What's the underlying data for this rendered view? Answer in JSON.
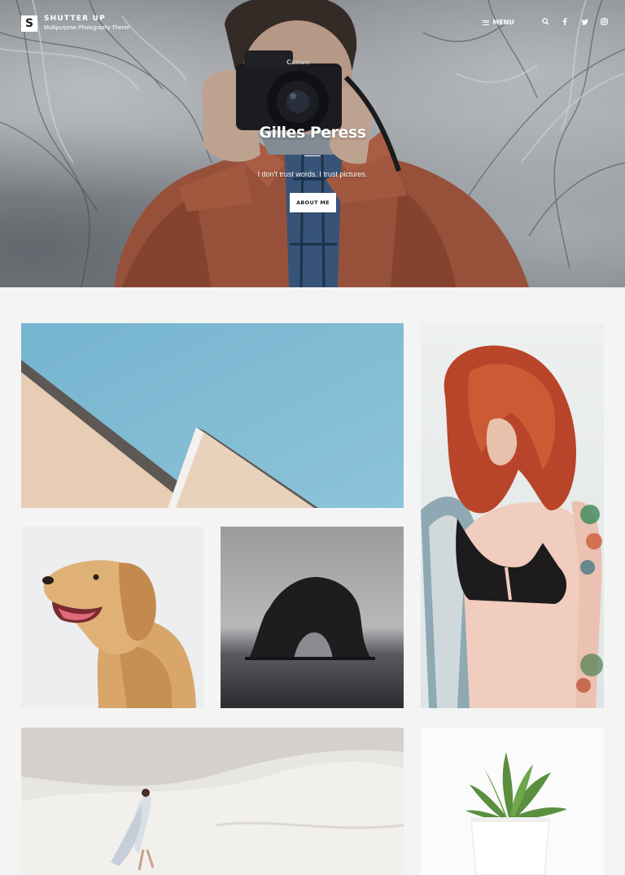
{
  "site": {
    "logo_letter": "S",
    "title": "SHUTTER UP",
    "tagline": "Multipurpose Photography Theme"
  },
  "nav": {
    "menu_label": "MENU",
    "icons": [
      "search-icon",
      "facebook-icon",
      "twitter-icon",
      "instagram-icon"
    ]
  },
  "hero": {
    "name": "Gilles Peress",
    "quote": "I don't trust words. I trust pictures.",
    "button_label": "ABOUT ME"
  },
  "gallery": {
    "items": [
      "architecture-sky-photo",
      "red-hair-woman-photo",
      "golden-retriever-photo",
      "sea-rock-arch-photo",
      "desert-dunes-woman-photo",
      "succulent-plant-photo"
    ]
  },
  "colors": {
    "sky": "#6fb0cc",
    "hair": "#b8452a",
    "jacket": "#b25c3f",
    "background": "#f4f4f4"
  }
}
